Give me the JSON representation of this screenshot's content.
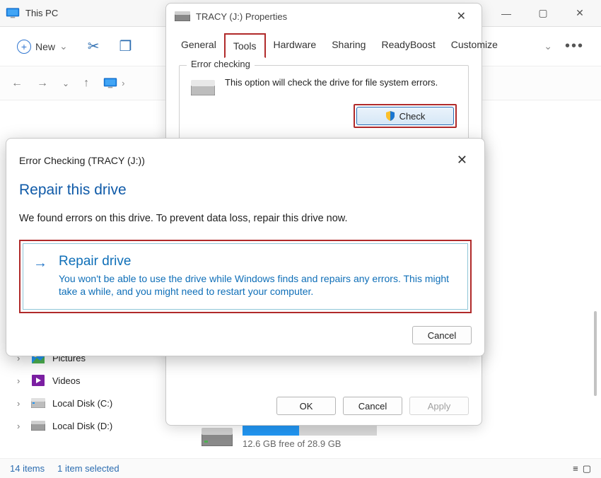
{
  "explorer": {
    "title": "This PC",
    "toolbar": {
      "new_label": "New",
      "chevron": "⌄"
    },
    "sidebar": {
      "items": [
        {
          "label": "Pictures"
        },
        {
          "label": "Videos"
        },
        {
          "label": "Local Disk (C:)"
        },
        {
          "label": "Local Disk (D:)"
        }
      ]
    },
    "drive_row": {
      "free_text": "12.6 GB free of 28.9 GB"
    },
    "status": {
      "count": "14 items",
      "selected": "1 item selected"
    }
  },
  "properties": {
    "title": "TRACY (J:) Properties",
    "tabs": [
      "General",
      "Tools",
      "Hardware",
      "Sharing",
      "ReadyBoost",
      "Customize"
    ],
    "active_tab_index": 1,
    "error_checking": {
      "group_label": "Error checking",
      "description": "This option will check the drive for file system errors.",
      "check_button": "Check"
    },
    "footer": {
      "ok": "OK",
      "cancel": "Cancel",
      "apply": "Apply"
    }
  },
  "error_dialog": {
    "title": "Error Checking (TRACY (J:))",
    "heading": "Repair this drive",
    "message": "We found errors on this drive. To prevent data loss, repair this drive now.",
    "repair_title": "Repair drive",
    "repair_desc": "You won't be able to use the drive while Windows finds and repairs any errors. This might take a while, and you might need to restart your computer.",
    "cancel": "Cancel"
  }
}
